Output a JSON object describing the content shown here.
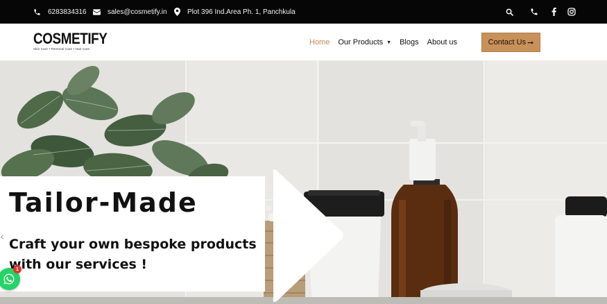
{
  "topbar": {
    "phone": "6283834316",
    "email": "sales@cosmetify.in",
    "address": "Plot 396 Ind.Area Ph. 1, Panchkula",
    "icons": [
      "search-icon",
      "phone-icon",
      "facebook-icon",
      "instagram-icon"
    ]
  },
  "header": {
    "logo": {
      "word": "COSMETIFY",
      "tagline": "Skin Care • Personal Care • Hair Care"
    },
    "nav": [
      {
        "label": "Home",
        "active": true
      },
      {
        "label": "Our Products",
        "has_dropdown": true,
        "caret": "▼"
      },
      {
        "label": "Blogs"
      },
      {
        "label": "About us"
      }
    ],
    "cta": {
      "label": "Contact Us",
      "arrow": "➞"
    }
  },
  "hero": {
    "title": "Tailor-Made",
    "subtitle": "Craft your own bespoke products with our services !",
    "prev_arrow": "‹"
  },
  "whatsapp": {
    "badge_count": "1"
  },
  "colors": {
    "topbar_bg": "#060606",
    "accent": "#c89159",
    "active_nav": "#c48a55",
    "whatsapp": "#25d366",
    "badge": "#e0352b"
  }
}
